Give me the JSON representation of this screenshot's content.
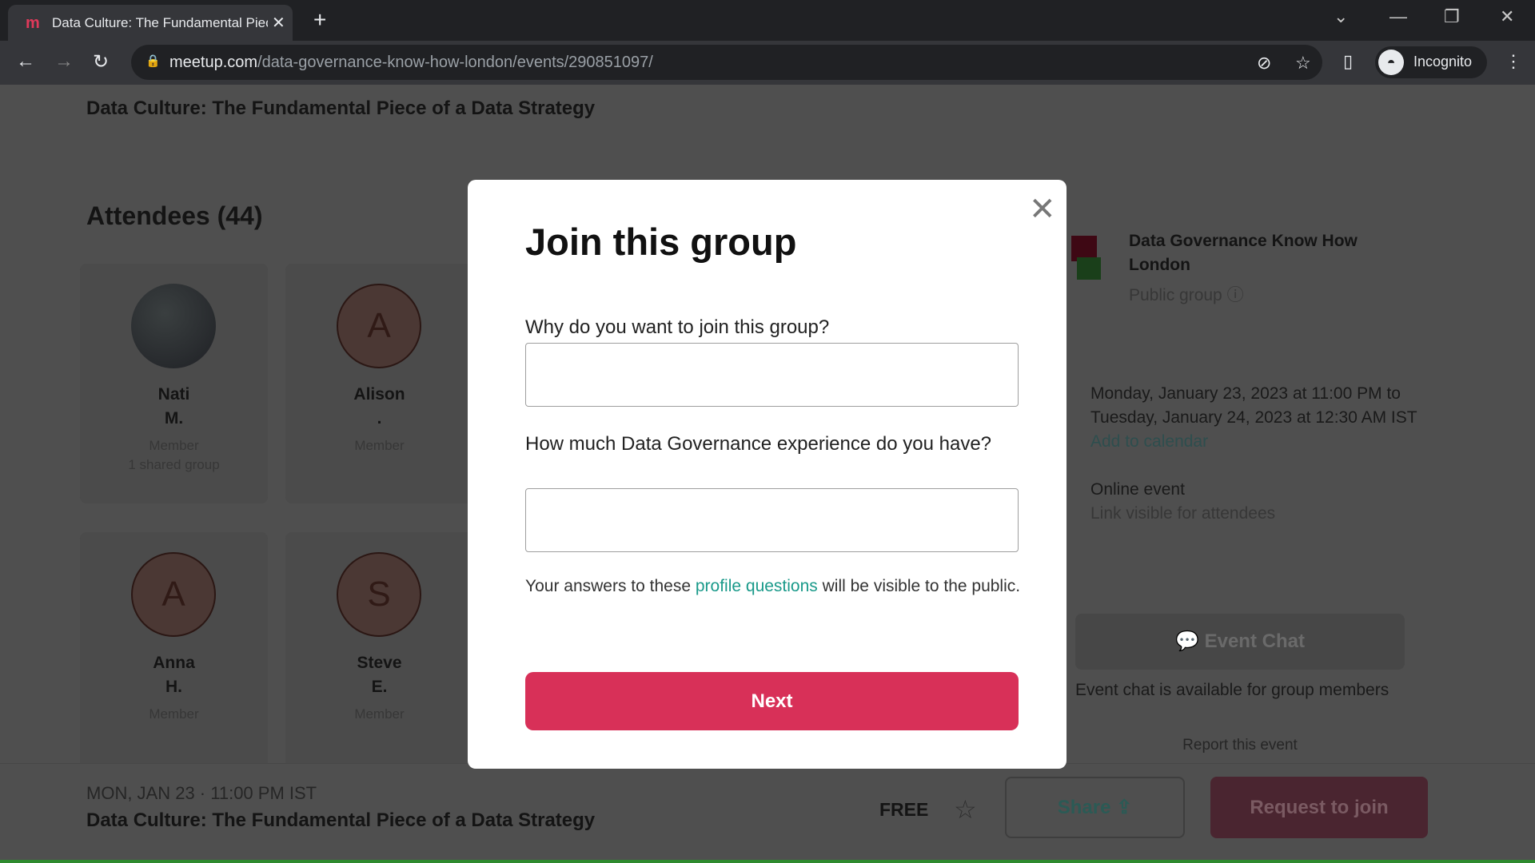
{
  "browser": {
    "tab_title": "Data Culture: The Fundamental Piece of a Data Strategy",
    "url_host": "meetup.com",
    "url_path": "/data-governance-know-how-london/events/290851097/",
    "profile": "Incognito"
  },
  "page": {
    "event_title": "Data Culture: The Fundamental Piece of a Data Strategy",
    "attendees_heading": "Attendees (44)",
    "attendees": [
      {
        "initial": "",
        "first": "Nati",
        "last": "M.",
        "role": "Member",
        "shared": "1 shared group"
      },
      {
        "initial": "A",
        "first": "Alison",
        "last": ".",
        "role": "Member",
        "shared": ""
      },
      {
        "initial": "A",
        "first": "Anna",
        "last": "H.",
        "role": "Member",
        "shared": ""
      },
      {
        "initial": "S",
        "first": "Steve",
        "last": "E.",
        "role": "Member",
        "shared": ""
      }
    ],
    "group": {
      "name": "Data Governance Know How London",
      "type": "Public group"
    },
    "datetime": "Monday, January 23, 2023 at 11:00 PM to Tuesday, January 24, 2023 at 12:30 AM IST",
    "add_calendar": "Add to calendar",
    "location": "Online event",
    "location_note": "Link visible for attendees",
    "chat_button": "Event Chat",
    "chat_note": "Event chat is available for group members",
    "report": "Report this event"
  },
  "footer": {
    "date": "MON, JAN 23 · 11:00 PM IST",
    "title": "Data Culture: The Fundamental Piece of a Data Strategy",
    "price": "FREE",
    "share": "Share",
    "request": "Request to join"
  },
  "modal": {
    "title": "Join this group",
    "q1": "Why do you want to join this group?",
    "a1": "",
    "q2": "How much Data Governance experience do you have?",
    "a2": "",
    "note_pre": "Your answers to these ",
    "note_link": "profile questions",
    "note_post": " will be visible to the public.",
    "next": "Next"
  },
  "colors": {
    "accent": "#d83058",
    "link": "#00798a"
  }
}
